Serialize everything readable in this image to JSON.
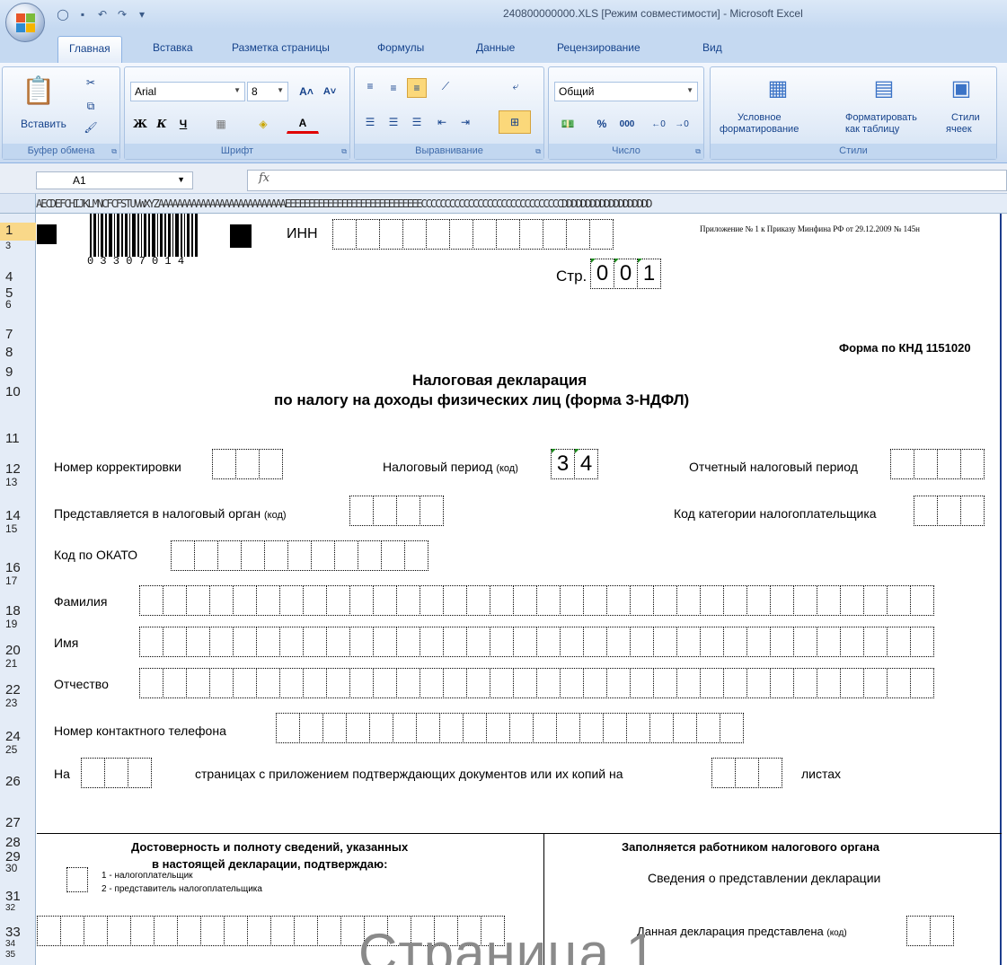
{
  "window": {
    "title": "240800000000.XLS  [Режим совместимости]  -  Microsoft Excel"
  },
  "tabs": [
    "Главная",
    "Вставка",
    "Разметка страницы",
    "Формулы",
    "Данные",
    "Рецензирование",
    "Вид"
  ],
  "ribbon": {
    "clipboard": {
      "paste": "Вставить",
      "label": "Буфер обмена"
    },
    "font": {
      "name": "Arial",
      "size": "8",
      "label": "Шрифт",
      "bold": "Ж",
      "italic": "К",
      "underline": "Ч"
    },
    "alignment": {
      "label": "Выравнивание"
    },
    "number": {
      "format": "Общий",
      "label": "Число",
      "percent": "%",
      "thousands": "000"
    },
    "styles": {
      "conditional_line1": "Условное",
      "conditional_line2": "форматирование",
      "format_table_line1": "Форматировать",
      "format_table_line2": "как таблицу",
      "cell_styles_line1": "Стили",
      "cell_styles_line2": "ячеек",
      "label": "Стили"
    }
  },
  "formula_bar": {
    "name_box": "A1",
    "fx": "fx",
    "value": ""
  },
  "column_header_letters": "AECDEFCHIJKLMNCFCFSTUVWXYZAAAAAAAAAAAAAAAAAAAAAAAAAAAEEEEEEEEEEEEEEEEEEEEEEEEEEEEECCCCCCCCCCCCCCCCCCCCCCCCCCCCCCDDDDDDDDDDDDDDDDDDD",
  "row_numbers": [
    "1",
    "3",
    "4",
    "5",
    "6",
    "7",
    "8",
    "9",
    "10",
    "11",
    "12",
    "13",
    "14",
    "15",
    "16",
    "17",
    "18",
    "19",
    "20",
    "21",
    "22",
    "23",
    "24",
    "25",
    "26",
    "27",
    "28",
    "29",
    "30",
    "31",
    "32",
    "33",
    "34",
    "35"
  ],
  "form": {
    "barcode_digits": "0 3 3 0   7 0 1 4",
    "inn_label": "ИНН",
    "appendix": "Приложение № 1 к Приказу Минфина РФ от 29.12.2009 № 145н",
    "page_label": "Стр.",
    "page_digits": [
      "0",
      "0",
      "1"
    ],
    "knd": "Форма по КНД 1151020",
    "title_line1": "Налоговая декларация",
    "title_line2": "по налогу на доходы физических лиц (форма 3-НДФЛ)",
    "correction_label": "Номер корректировки",
    "tax_period_label": "Налоговый период",
    "tax_period_code_note": "(код)",
    "tax_period_digits": [
      "3",
      "4"
    ],
    "reporting_year_label": "Отчетный налоговый период",
    "tax_authority_label": "Представляется в налоговый орган",
    "tax_authority_code_note": "(код)",
    "taxpayer_category_label": "Код категории налогоплательщика",
    "okato_label": "Код по ОКАТО",
    "surname_label": "Фамилия",
    "name_label": "Имя",
    "patronymic_label": "Отчество",
    "phone_label": "Номер контактного телефона",
    "pages_on_label": "На",
    "pages_text": "страницах с приложением подтверждающих документов или их копий на",
    "sheets_label": "листах",
    "confirm_line1": "Достоверность и полноту сведений, указанных",
    "confirm_line2": "в настоящей декларации, подтверждаю:",
    "option1": "1 - налогоплательщик",
    "option2": "2 - представитель налогоплательщика",
    "office_header": "Заполняется работником налогового органа",
    "office_sub": "Сведения о представлении декларации",
    "declaration_submitted": "Данная декларация представлена",
    "declaration_code_note": "(код)",
    "watermark": "Страница 1"
  }
}
